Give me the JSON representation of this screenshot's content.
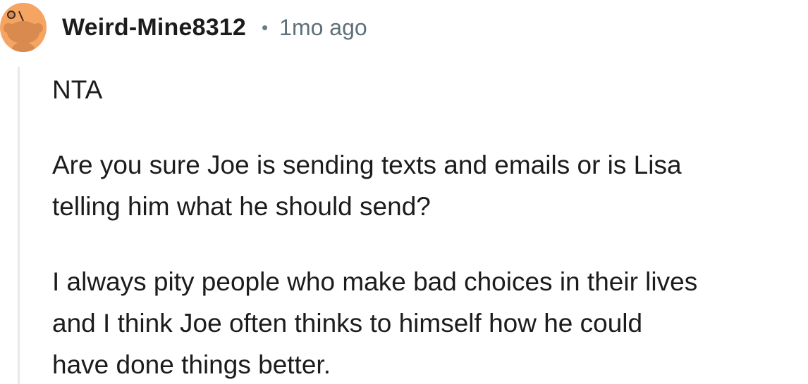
{
  "comment": {
    "author": "Weird-Mine8312",
    "separator": "•",
    "timestamp": "1mo ago",
    "avatar_icon": "reddit-snoo-avatar-icon",
    "colors": {
      "avatar_bg": "#f5a462",
      "thread_line": "#e7e9eb",
      "text": "#1c1c1c",
      "meta": "#5f6f79"
    },
    "paragraphs": [
      [
        "NTA"
      ],
      [
        "Are you sure Joe is sending texts and emails or is Lisa",
        "telling him what he should send?"
      ],
      [
        "I always pity people who make bad choices in their lives",
        "and I think Joe often thinks to himself how he could",
        "have done things better."
      ]
    ]
  }
}
